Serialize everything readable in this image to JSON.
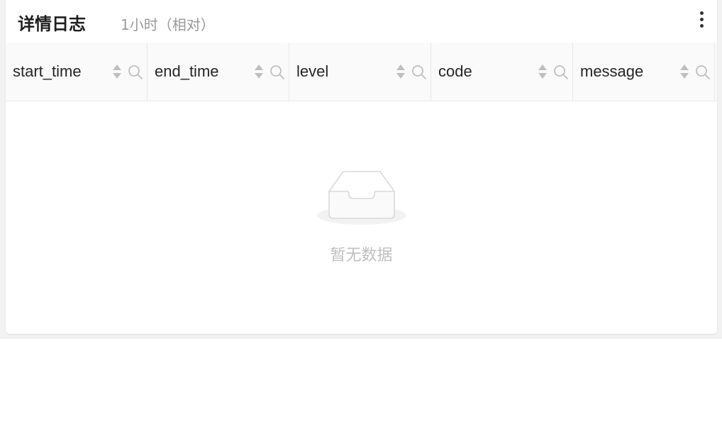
{
  "panel": {
    "title": "详情日志",
    "subtitle": "1小时（相对）",
    "more_icon": "more-vertical-icon"
  },
  "table": {
    "columns": [
      {
        "label": "start_time",
        "sort_icon": "sort-icon",
        "filter_icon": "search-icon"
      },
      {
        "label": "end_time",
        "sort_icon": "sort-icon",
        "filter_icon": "search-icon"
      },
      {
        "label": "level",
        "sort_icon": "sort-icon",
        "filter_icon": "search-icon"
      },
      {
        "label": "code",
        "sort_icon": "sort-icon",
        "filter_icon": "search-icon"
      },
      {
        "label": "message",
        "sort_icon": "sort-icon",
        "filter_icon": "search-icon"
      }
    ],
    "rows": [],
    "empty_text": "暂无数据",
    "empty_icon": "empty-inbox-icon"
  },
  "colors": {
    "header_bg": "#fafafa",
    "border": "#e8e8e8",
    "icon_gray": "#bfbfbf",
    "title": "#1f1f1f",
    "subtitle": "#9a9a9a"
  }
}
